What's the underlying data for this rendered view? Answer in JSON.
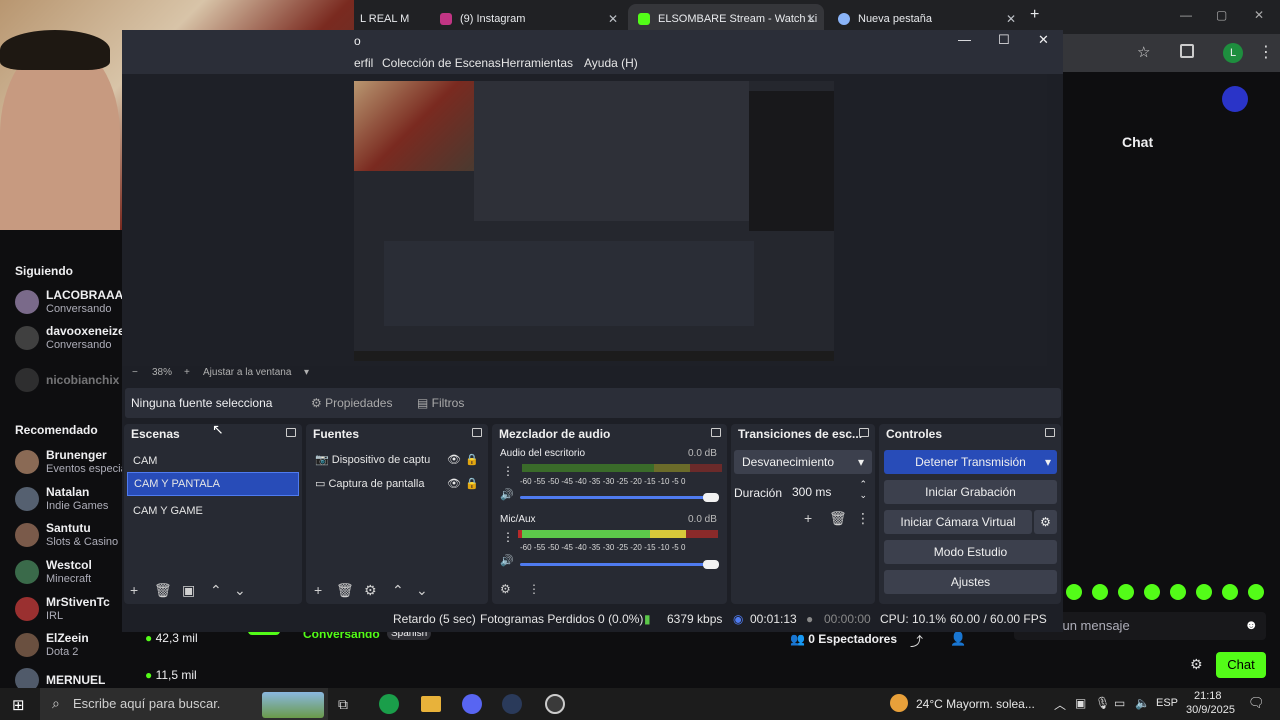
{
  "browser": {
    "tabs": [
      {
        "title": "L REAL M",
        "favicon_color": "#3b3b3b"
      },
      {
        "title": "(9) Instagram",
        "favicon_color": "#c13584"
      },
      {
        "title": "ELSOMBARE Stream - Watch Li",
        "favicon_color": "#53fc18"
      },
      {
        "title": "Nueva pestaña",
        "favicon_color": "#8ab4f8"
      }
    ],
    "new_tab": "+",
    "profile_initial": "L"
  },
  "twitch": {
    "following_heading": "Siguiendo",
    "following": [
      {
        "name": "LACOBRAAA",
        "sub": "Conversando",
        "avatar_color": "#7a6a8a"
      },
      {
        "name": "davooxeneize",
        "sub": "Conversando",
        "avatar_color": "#404040"
      },
      {
        "name": "nicobianchix",
        "sub": "",
        "avatar_color": "#555555"
      }
    ],
    "recommended_heading": "Recomendado",
    "recommended": [
      {
        "name": "Brunenger",
        "sub": "Eventos especia",
        "avatar_color": "#8a6a55"
      },
      {
        "name": "Natalan",
        "sub": "Indie Games",
        "avatar_color": "#556070"
      },
      {
        "name": "Santutu",
        "sub": "Slots & Casino",
        "avatar_color": "#7a5a4a"
      },
      {
        "name": "Westcol",
        "sub": "Minecraft",
        "avatar_color": "#3a6a4a"
      },
      {
        "name": "MrStivenTc",
        "sub": "IRL",
        "avatar_color": "#9a3030"
      },
      {
        "name": "ElZeein",
        "sub": "Dota 2",
        "avatar_color": "#6a5040"
      },
      {
        "name": "MERNUEL",
        "sub": "",
        "avatar_color": "#505a6a"
      }
    ],
    "viewer_counts": [
      "42,3 mil",
      "11,5 mil"
    ],
    "conversando_tag": "Conversando",
    "spanish_tag": "Spanish",
    "viewers": "0 Espectadores",
    "chat_title": "Chat",
    "chat_placeholder": "Enviar un mensaje",
    "chat_button": "Chat"
  },
  "obs": {
    "menu": [
      "erfil",
      "Colección de Escenas",
      "Herramientas",
      "Ayuda (H)"
    ],
    "title_fragment": "o",
    "zoom_minus": "−",
    "zoom": "38%",
    "zoom_plus": "+",
    "fit": "Ajustar a la ventana",
    "no_source": "Ninguna fuente selecciona",
    "properties": "Propiedades",
    "filters": "Filtros",
    "scenes_title": "Escenas",
    "scenes": [
      "CAM",
      "CAM Y PANTALA",
      "CAM Y GAME"
    ],
    "selected_scene": 1,
    "sources_title": "Fuentes",
    "sources": [
      "Dispositivo de captu",
      "Captura de pantalla"
    ],
    "mixer_title": "Mezclador de audio",
    "mixer": [
      {
        "name": "Audio del escritorio",
        "db": "0.0 dB"
      },
      {
        "name": "Mic/Aux",
        "db": "0.0 dB"
      }
    ],
    "mixer_scale": "-60 -55 -50 -45 -40 -35 -30 -25 -20 -15 -10  -5   0",
    "transitions_title": "Transiciones de esc...",
    "transition": "Desvanecimiento",
    "duration_label": "Duración",
    "duration": "300 ms",
    "controls_title": "Controles",
    "controls": [
      "Detener Transmisión",
      "Iniciar Grabación",
      "Iniciar Cámara Virtual",
      "Modo Estudio",
      "Ajustes"
    ],
    "status": {
      "delay": "Retardo (5 sec)",
      "dropped": "Fotogramas Perdidos 0 (0.0%)",
      "bitrate": "6379 kbps",
      "stream_time": "00:01:13",
      "rec_time": "00:00:00",
      "cpu": "CPU: 10.1%",
      "fps": "60.00 / 60.00 FPS"
    }
  },
  "taskbar": {
    "search_placeholder": "Escribe aquí para buscar.",
    "weather": "24°C  Mayorm. solea...",
    "lang": "ESP",
    "time": "21:18",
    "date": "30/9/2025"
  }
}
